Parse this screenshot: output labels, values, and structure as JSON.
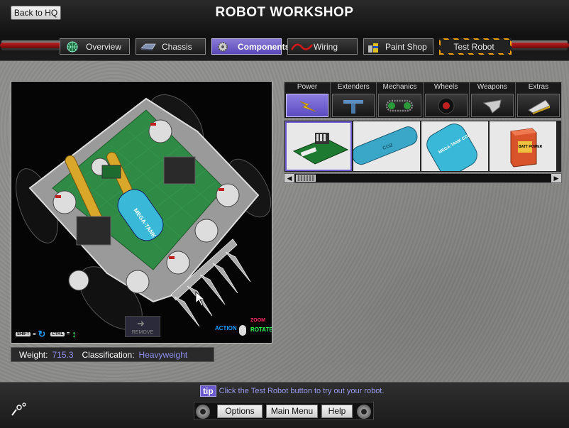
{
  "header": {
    "back_label": "Back to HQ",
    "title": "ROBOT WORKSHOP"
  },
  "tabs": [
    {
      "label": "Overview",
      "icon": "globe-icon",
      "active": false
    },
    {
      "label": "Chassis",
      "icon": "chassis-icon",
      "active": false
    },
    {
      "label": "Components",
      "icon": "gear-icon",
      "active": true
    },
    {
      "label": "Wiring",
      "icon": "wire-icon",
      "active": false
    },
    {
      "label": "Paint Shop",
      "icon": "paint-cans-icon",
      "active": false
    },
    {
      "label": "Test Robot",
      "icon": "",
      "active": false
    }
  ],
  "viewport": {
    "shift_key": "SHIFT",
    "ctrl_key": "CTRL",
    "remove_label": "REMOVE",
    "action_label": "ACTION",
    "zoom_label": "ZOOM",
    "rotate_label": "ROTATE",
    "battery_label": "MEGA-TANK"
  },
  "stats": {
    "weight_label": "Weight:",
    "weight_value": "715.3",
    "class_label": "Classification:",
    "class_value": "Heavyweight"
  },
  "components": {
    "categories": [
      {
        "label": "Power",
        "icon": "lightning-icon",
        "active": true
      },
      {
        "label": "Extenders",
        "icon": "extender-icon",
        "active": false
      },
      {
        "label": "Mechanics",
        "icon": "chain-icon",
        "active": false
      },
      {
        "label": "Wheels",
        "icon": "wheel-icon",
        "active": false
      },
      {
        "label": "Weapons",
        "icon": "blade-icon",
        "active": false
      },
      {
        "label": "Extras",
        "icon": "plow-icon",
        "active": false
      }
    ],
    "items": [
      {
        "name": "speed-controller-item",
        "selected": true
      },
      {
        "name": "tank-item-1",
        "text": "CO2",
        "selected": false
      },
      {
        "name": "tank-item-2",
        "text": "MEGA-TANK CO2",
        "selected": false
      },
      {
        "name": "battery-item",
        "text": "BATT POWER",
        "selected": false
      }
    ]
  },
  "footer": {
    "tip_badge": "tip",
    "tip_text": "Click the Test Robot button to try out your robot.",
    "options_label": "Options",
    "main_menu_label": "Main Menu",
    "help_label": "Help"
  },
  "colors": {
    "accent": "#6a5acd",
    "stat_value": "#8f8ff0",
    "tip_text": "#9a9aee"
  }
}
